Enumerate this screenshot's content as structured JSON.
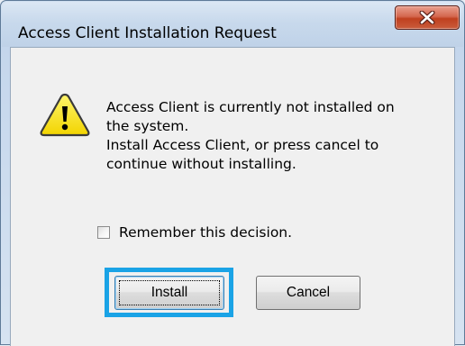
{
  "dialog": {
    "title": "Access Client Installation Request",
    "close_symbol": "X",
    "icon": "warning-icon",
    "message_lines": [
      "Access Client is currently not installed on",
      "the system.",
      "Install Access Client, or press cancel to",
      "continue without installing."
    ],
    "remember_checkbox": {
      "label": "Remember this decision.",
      "checked": false
    },
    "buttons": {
      "install": "Install",
      "cancel": "Cancel"
    },
    "colors": {
      "highlight": "#1aa3e6",
      "close_button": "#c0401f",
      "warning_fill": "#f7e400"
    }
  }
}
